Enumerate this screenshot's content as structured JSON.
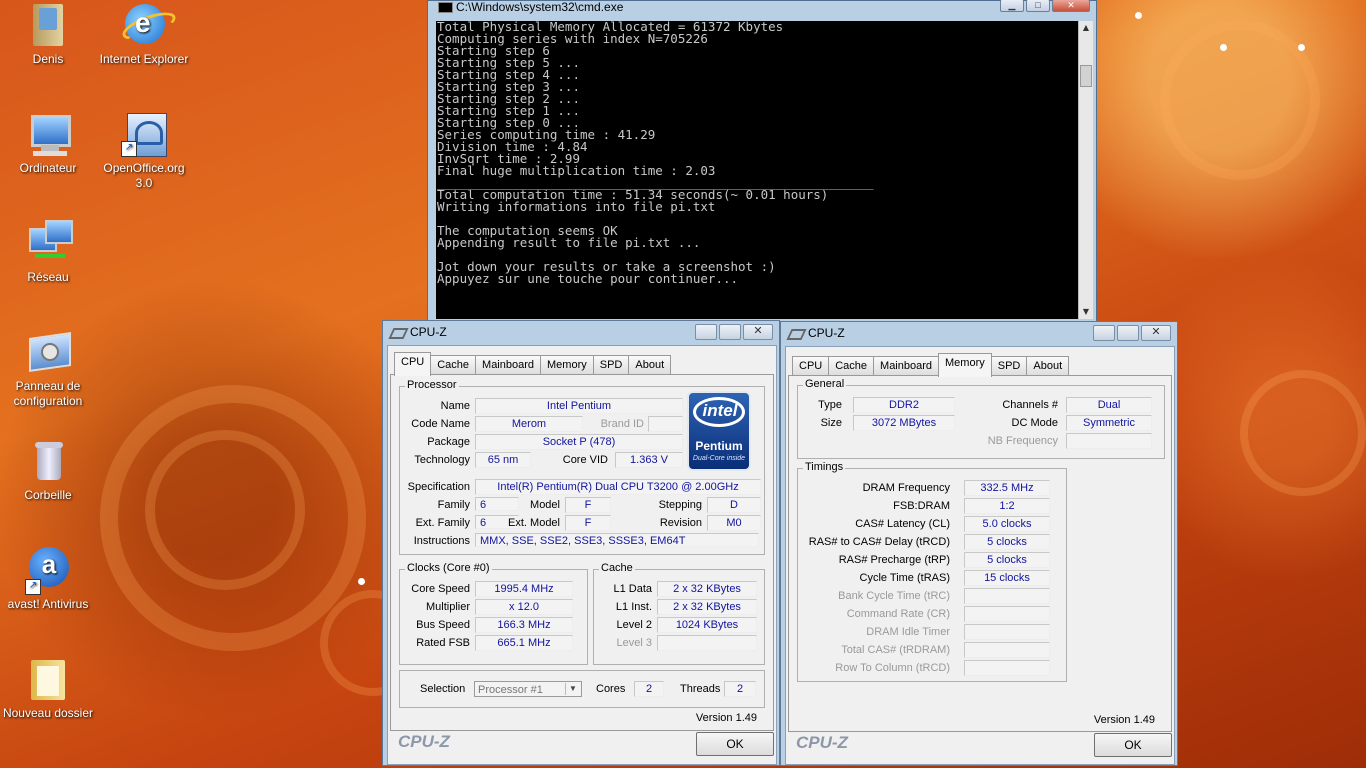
{
  "desktop": {
    "icons": [
      {
        "label": "Denis",
        "icon": "user-folder-icon"
      },
      {
        "label": "Internet Explorer",
        "icon": "internet-explorer-icon"
      },
      {
        "label": "Ordinateur",
        "icon": "computer-icon"
      },
      {
        "label": "OpenOffice.org 3.0",
        "icon": "openoffice-icon"
      },
      {
        "label": "Réseau",
        "icon": "network-icon"
      },
      {
        "label": "Panneau de configuration",
        "icon": "control-panel-icon"
      },
      {
        "label": "Corbeille",
        "icon": "recycle-bin-icon"
      },
      {
        "label": "avast! Antivirus",
        "icon": "avast-icon"
      },
      {
        "label": "Nouveau dossier",
        "icon": "folder-icon"
      }
    ]
  },
  "cmd": {
    "title": "C:\\Windows\\system32\\cmd.exe",
    "lines": [
      "Total Physical Memory Allocated = 61372 Kbytes",
      "Computing series with index N=705226",
      "Starting step 6",
      "Starting step 5 ...",
      "Starting step 4 ...",
      "Starting step 3 ...",
      "Starting step 2 ...",
      "Starting step 1 ...",
      "Starting step 0 ...",
      "Series computing time : 41.29",
      "Division time : 4.84",
      "InvSqrt time : 2.99",
      "Final huge multiplication time : 2.03",
      "__________________________________________________________",
      "Total computation time : 51.34 seconds(~ 0.01 hours)",
      "Writing informations into file pi.txt",
      "",
      "The computation seems OK",
      "Appending result to file pi.txt ...",
      "",
      "Jot down your results or take a screenshot :)",
      "Appuyez sur une touche pour continuer..."
    ]
  },
  "cpuz_cpu": {
    "title": "CPU-Z",
    "tabs": [
      "CPU",
      "Cache",
      "Mainboard",
      "Memory",
      "SPD",
      "About"
    ],
    "active_tab": "CPU",
    "processor": {
      "group": "Processor",
      "name_label": "Name",
      "name": "Intel Pentium",
      "codename_label": "Code Name",
      "codename": "Merom",
      "brandid_label": "Brand ID",
      "brandid": "",
      "package_label": "Package",
      "package": "Socket P (478)",
      "technology_label": "Technology",
      "technology": "65 nm",
      "corevid_label": "Core VID",
      "corevid": "1.363 V",
      "spec_label": "Specification",
      "spec": "Intel(R) Pentium(R) Dual  CPU  T3200  @ 2.00GHz",
      "family_label": "Family",
      "family": "6",
      "model_label": "Model",
      "model": "F",
      "stepping_label": "Stepping",
      "stepping": "D",
      "extfamily_label": "Ext. Family",
      "extfamily": "6",
      "extmodel_label": "Ext. Model",
      "extmodel": "F",
      "revision_label": "Revision",
      "revision": "M0",
      "instr_label": "Instructions",
      "instr": "MMX, SSE, SSE2, SSE3, SSSE3, EM64T"
    },
    "logo": {
      "brand": "intel",
      "product": "Pentium",
      "sub": "Dual-Core inside"
    },
    "clocks": {
      "group": "Clocks (Core #0)",
      "corespeed_label": "Core Speed",
      "corespeed": "1995.4 MHz",
      "multiplier_label": "Multiplier",
      "multiplier": "x 12.0",
      "busspeed_label": "Bus Speed",
      "busspeed": "166.3 MHz",
      "ratedfsb_label": "Rated FSB",
      "ratedfsb": "665.1 MHz"
    },
    "cache": {
      "group": "Cache",
      "l1data_label": "L1 Data",
      "l1data": "2 x 32 KBytes",
      "l1inst_label": "L1 Inst.",
      "l1inst": "2 x 32 KBytes",
      "level2_label": "Level 2",
      "level2": "1024 KBytes",
      "level3_label": "Level 3",
      "level3": ""
    },
    "selection_label": "Selection",
    "selection": "Processor #1",
    "cores_label": "Cores",
    "cores": "2",
    "threads_label": "Threads",
    "threads": "2",
    "version": "Version 1.49",
    "brand": "CPU-Z",
    "ok": "OK"
  },
  "cpuz_mem": {
    "title": "CPU-Z",
    "tabs": [
      "CPU",
      "Cache",
      "Mainboard",
      "Memory",
      "SPD",
      "About"
    ],
    "active_tab": "Memory",
    "general": {
      "group": "General",
      "type_label": "Type",
      "type": "DDR2",
      "size_label": "Size",
      "size": "3072 MBytes",
      "channels_label": "Channels #",
      "channels": "Dual",
      "dcmode_label": "DC Mode",
      "dcmode": "Symmetric",
      "nbfreq_label": "NB Frequency",
      "nbfreq": ""
    },
    "timings": {
      "group": "Timings",
      "rows": [
        {
          "label": "DRAM Frequency",
          "value": "332.5 MHz",
          "dim": false
        },
        {
          "label": "FSB:DRAM",
          "value": "1:2",
          "dim": false
        },
        {
          "label": "CAS# Latency (CL)",
          "value": "5.0 clocks",
          "dim": false
        },
        {
          "label": "RAS# to CAS# Delay (tRCD)",
          "value": "5 clocks",
          "dim": false
        },
        {
          "label": "RAS# Precharge (tRP)",
          "value": "5 clocks",
          "dim": false
        },
        {
          "label": "Cycle Time (tRAS)",
          "value": "15 clocks",
          "dim": false
        },
        {
          "label": "Bank Cycle Time (tRC)",
          "value": "",
          "dim": true
        },
        {
          "label": "Command Rate (CR)",
          "value": "",
          "dim": true
        },
        {
          "label": "DRAM Idle Timer",
          "value": "",
          "dim": true
        },
        {
          "label": "Total CAS# (tRDRAM)",
          "value": "",
          "dim": true
        },
        {
          "label": "Row To Column (tRCD)",
          "value": "",
          "dim": true
        }
      ]
    },
    "version": "Version 1.49",
    "brand": "CPU-Z",
    "ok": "OK"
  }
}
